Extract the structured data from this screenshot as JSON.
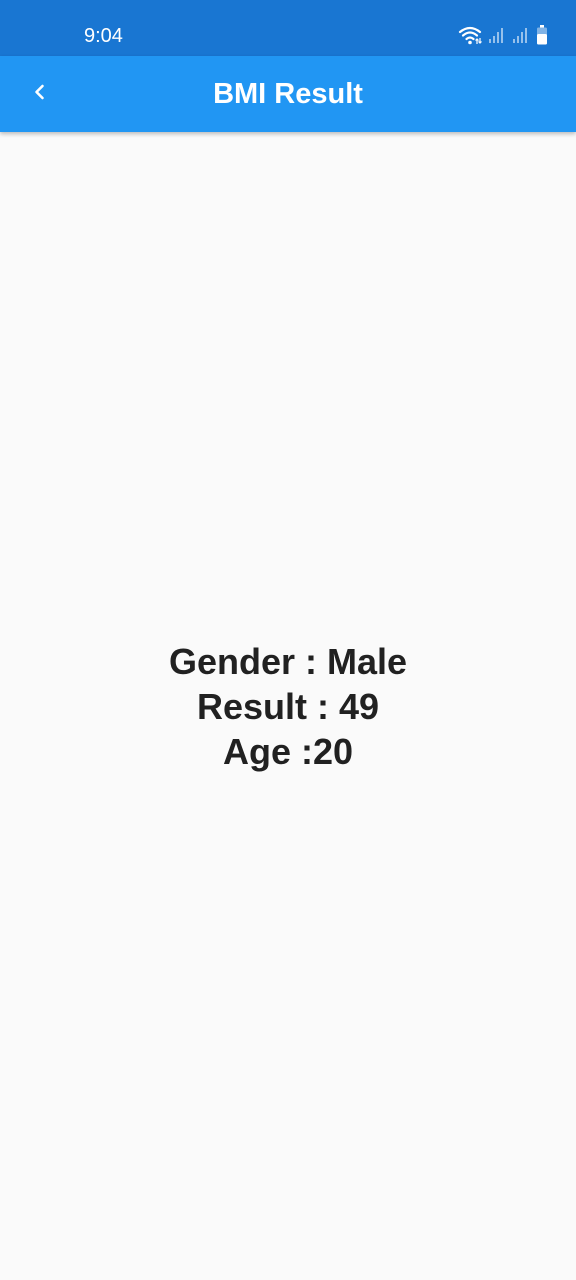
{
  "status_bar": {
    "time": "9:04",
    "icons": [
      "wifi-icon",
      "signal-icon",
      "signal-icon",
      "battery-icon"
    ]
  },
  "app_bar": {
    "title": "BMI Result",
    "back_icon": "chevron-left-icon"
  },
  "result": {
    "gender_line": "Gender : Male",
    "result_line": "Result : 49",
    "age_line": "Age :20"
  },
  "colors": {
    "status_bar": "#1976d2",
    "app_bar": "#2196f3",
    "background": "#fafafa",
    "text": "#212121"
  }
}
